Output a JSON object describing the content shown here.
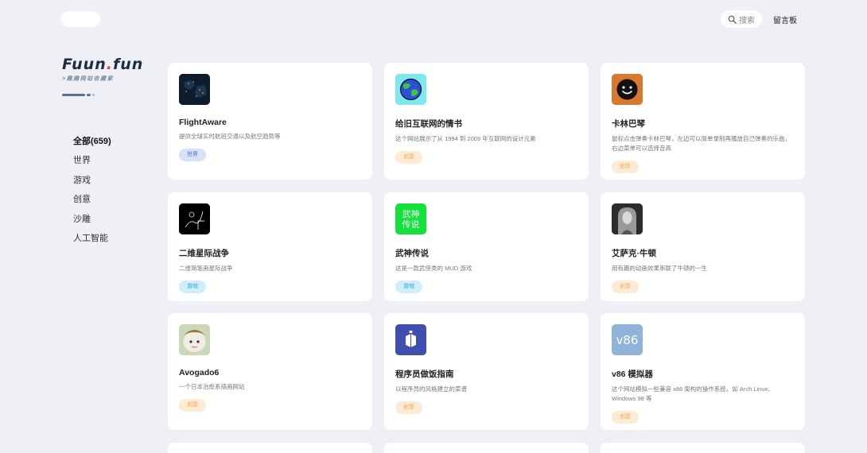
{
  "header": {
    "search_label": "搜索",
    "guestbook": "留言板"
  },
  "logo": {
    "title_main": "Fuun",
    "title_dot": ".",
    "title_tail": "fun",
    "subtitle": ">趣趣网站收藏家"
  },
  "nav": {
    "items": [
      {
        "label": "全部(659)"
      },
      {
        "label": "世界"
      },
      {
        "label": "游戏"
      },
      {
        "label": "创意"
      },
      {
        "label": "沙雕"
      },
      {
        "label": "人工智能"
      }
    ]
  },
  "cards": [
    {
      "name": "FlightAware",
      "desc": "提供全球实时航班交通以及航空趋势等",
      "tag": "世界",
      "tag_type": "world",
      "icon": "flight-map-icon"
    },
    {
      "name": "给旧互联网的情书",
      "desc": "这个网站展示了从 1994 到 2009 年互联网的设计元素",
      "tag": "创意",
      "tag_type": "creative",
      "icon": "globe-icon"
    },
    {
      "name": "卡林巴琴",
      "desc": "鼠标点击弹奏卡林巴琴，左边可以简单录制再播放自己弹奏的乐曲，右边菜单可以选择音高",
      "tag": "创意",
      "tag_type": "creative",
      "icon": "smiley-icon"
    },
    {
      "name": "二维星际战争",
      "desc": "二维简笔画星际战争",
      "tag": "游戏",
      "tag_type": "game",
      "icon": "sketch-icon"
    },
    {
      "name": "武神传说",
      "desc": "这是一款武侠类的 MUD 游戏",
      "tag": "游戏",
      "tag_type": "game",
      "icon": "wushen-icon",
      "icon_text": "武神\n传说"
    },
    {
      "name": "艾萨克·牛顿",
      "desc": "用有趣的动画效果串联了牛顿的一生",
      "tag": "创意",
      "tag_type": "creative",
      "icon": "newton-portrait-icon"
    },
    {
      "name": "Avogado6",
      "desc": "一个日本治愈系插画网站",
      "tag": "创意",
      "tag_type": "creative",
      "icon": "illustration-icon"
    },
    {
      "name": "程序员做饭指南",
      "desc": "以程序员的风格建立的菜谱",
      "tag": "创意",
      "tag_type": "creative",
      "icon": "cookbook-icon"
    },
    {
      "name": "v86 模拟器",
      "desc": "这个网站模拟一些兼容 x86 架构的操作系统，如 Arch Linux、Windows 98 等",
      "tag": "创意",
      "tag_type": "creative",
      "icon": "v86-icon",
      "icon_text": "v86"
    }
  ],
  "colors": {
    "background": "#eef0f5",
    "card": "#ffffff",
    "logo_dot": "#e8452e"
  }
}
